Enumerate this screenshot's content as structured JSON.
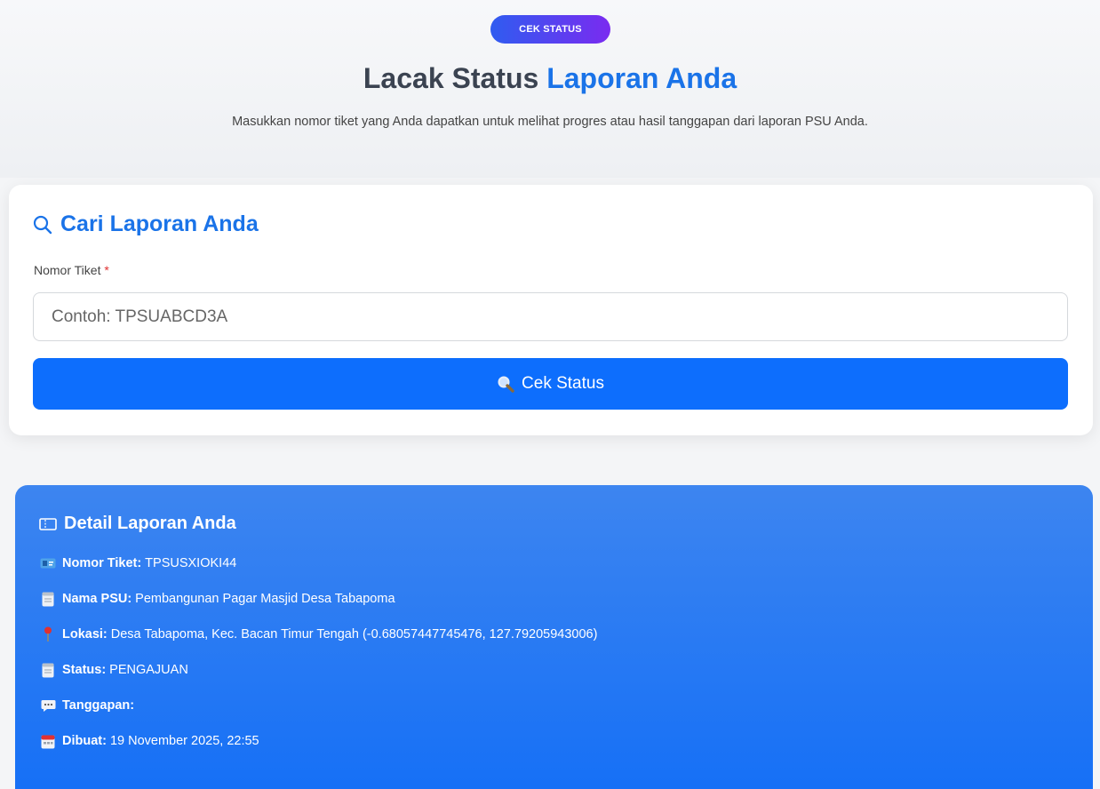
{
  "hero": {
    "badge": "CEK STATUS",
    "title_main": "Lacak Status",
    "title_accent": "Laporan Anda",
    "subtitle": "Masukkan nomor tiket yang Anda dapatkan untuk melihat progres atau hasil tanggapan dari laporan PSU Anda."
  },
  "search_card": {
    "title": "Cari Laporan Anda",
    "field_label": "Nomor Tiket",
    "required_mark": "*",
    "placeholder": "Contoh: TPSUABCD3A",
    "value": "",
    "button_label": "Cek Status"
  },
  "detail": {
    "title": "Detail Laporan Anda",
    "rows": [
      {
        "icon": "id-card-icon",
        "label": "Nomor Tiket:",
        "value": "TPSUSXIOKI44"
      },
      {
        "icon": "document-icon",
        "label": "Nama PSU:",
        "value": "Pembangunan Pagar Masjid Desa Tabapoma"
      },
      {
        "icon": "pin-icon",
        "label": "Lokasi:",
        "value": "Desa Tabapoma, Kec. Bacan Timur Tengah (-0.68057447745476, 127.79205943006)"
      },
      {
        "icon": "document-icon",
        "label": "Status:",
        "value": "PENGAJUAN"
      },
      {
        "icon": "speech-bubble-icon",
        "label": "Tanggapan:",
        "value": ""
      },
      {
        "icon": "calendar-icon",
        "label": "Dibuat:",
        "value": "19 November 2025, 22:55"
      }
    ]
  },
  "colors": {
    "accent": "#1a73e8",
    "button": "#0d6efd",
    "detail_bg": "#1670f6"
  }
}
